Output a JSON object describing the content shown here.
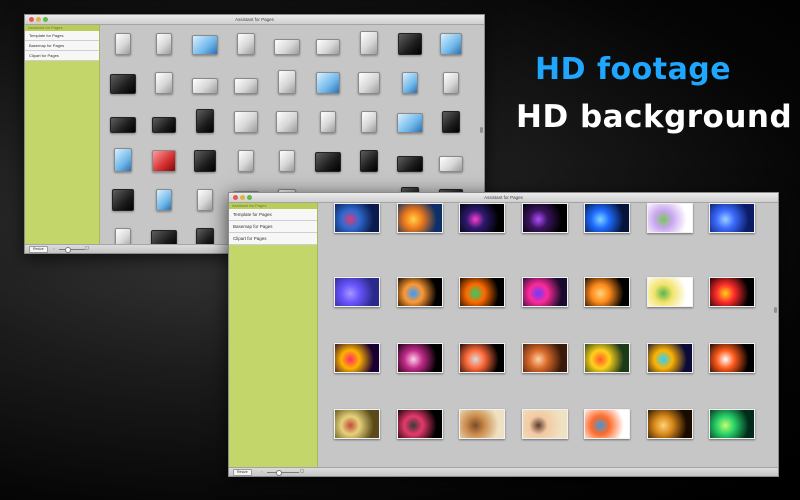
{
  "headlines": {
    "line1": "HD footage",
    "line2": "HD background",
    "color1": "#1fa6ff",
    "color2": "#ffffff"
  },
  "back_window": {
    "title": "Assistant for Pages",
    "sidebar_header": "Assistant for Pages",
    "sidebar_items": [
      "Template for Pages",
      "Basemap for Pages",
      "Clipart for Pages"
    ],
    "resize_label": "Resize",
    "zoom_small_icon": "zoom-out-icon",
    "zoom_large_icon": "zoom-in-icon",
    "zoom_level": 0.3,
    "sidebar_color": "#c2d66a",
    "items": [
      {
        "style": "light",
        "caption": ""
      },
      {
        "style": "light",
        "caption": ""
      },
      {
        "style": "blue",
        "caption": ""
      },
      {
        "style": "light",
        "caption": ""
      },
      {
        "style": "light",
        "caption": ""
      },
      {
        "style": "light",
        "caption": ""
      },
      {
        "style": "light",
        "caption": ""
      },
      {
        "style": "dark",
        "caption": ""
      },
      {
        "style": "blue",
        "caption": ""
      },
      {
        "style": "dark",
        "caption": ""
      },
      {
        "style": "light",
        "caption": ""
      },
      {
        "style": "light",
        "caption": ""
      },
      {
        "style": "light",
        "caption": ""
      },
      {
        "style": "light",
        "caption": ""
      },
      {
        "style": "blue",
        "caption": ""
      },
      {
        "style": "light",
        "caption": ""
      },
      {
        "style": "blue",
        "caption": ""
      },
      {
        "style": "light",
        "caption": ""
      },
      {
        "style": "dark",
        "caption": ""
      },
      {
        "style": "dark",
        "caption": ""
      },
      {
        "style": "dark",
        "caption": ""
      },
      {
        "style": "light",
        "caption": ""
      },
      {
        "style": "light",
        "caption": ""
      },
      {
        "style": "light",
        "caption": ""
      },
      {
        "style": "light",
        "caption": ""
      },
      {
        "style": "blue",
        "caption": ""
      },
      {
        "style": "dark",
        "caption": ""
      },
      {
        "style": "blue",
        "caption": ""
      },
      {
        "style": "red",
        "caption": ""
      },
      {
        "style": "dark",
        "caption": ""
      },
      {
        "style": "light",
        "caption": ""
      },
      {
        "style": "light",
        "caption": ""
      },
      {
        "style": "dark",
        "caption": ""
      },
      {
        "style": "dark",
        "caption": ""
      },
      {
        "style": "dark",
        "caption": ""
      },
      {
        "style": "light",
        "caption": ""
      },
      {
        "style": "dark",
        "caption": ""
      },
      {
        "style": "blue",
        "caption": ""
      },
      {
        "style": "light",
        "caption": ""
      },
      {
        "style": "light",
        "caption": ""
      },
      {
        "style": "light",
        "caption": ""
      },
      {
        "style": "light",
        "caption": ""
      },
      {
        "style": "light",
        "caption": ""
      },
      {
        "style": "dark",
        "caption": ""
      },
      {
        "style": "dark",
        "caption": ""
      },
      {
        "style": "light",
        "caption": ""
      },
      {
        "style": "dark",
        "caption": ""
      },
      {
        "style": "dark",
        "caption": ""
      }
    ]
  },
  "front_window": {
    "title": "Assistant for Pages",
    "sidebar_header": "Assistant for Pages",
    "sidebar_items": [
      "Template for Pages",
      "Basemap for Pages",
      "Clipart for Pages"
    ],
    "resize_label": "Resize",
    "zoom_small_icon": "zoom-out-icon",
    "zoom_large_icon": "zoom-in-icon",
    "zoom_level": 0.35,
    "sidebar_color": "#c2d66a",
    "items": [
      {
        "colors": [
          "#0b1b4d",
          "#2f6bd1",
          "#d93b7c"
        ],
        "caption": ""
      },
      {
        "colors": [
          "#0b2f66",
          "#f07a1a",
          "#ffd24a"
        ],
        "caption": ""
      },
      {
        "colors": [
          "#000000",
          "#2c1a6e",
          "#ff3bd0"
        ],
        "caption": ""
      },
      {
        "colors": [
          "#000000",
          "#3a145e",
          "#b24dff"
        ],
        "caption": ""
      },
      {
        "colors": [
          "#06133a",
          "#1e6bff",
          "#7fd6ff"
        ],
        "caption": ""
      },
      {
        "colors": [
          "#ffffff",
          "#c9a6f0",
          "#7ac55c"
        ],
        "caption": ""
      },
      {
        "colors": [
          "#0b1b66",
          "#3c6bff",
          "#9ad0ff"
        ],
        "caption": ""
      },
      {
        "colors": [
          "#2a2a8a",
          "#6a55ff",
          "#a699ff"
        ],
        "caption": ""
      },
      {
        "colors": [
          "#000000",
          "#ff9933",
          "#3399ff"
        ],
        "caption": ""
      },
      {
        "colors": [
          "#000000",
          "#ff6a00",
          "#2ad16a"
        ],
        "caption": ""
      },
      {
        "colors": [
          "#1a0b2e",
          "#ff2a9a",
          "#6a3bff"
        ],
        "caption": ""
      },
      {
        "colors": [
          "#000000",
          "#ff8a1a",
          "#ffd47a"
        ],
        "caption": ""
      },
      {
        "colors": [
          "#ffffff",
          "#f2e36a",
          "#5ab44a"
        ],
        "caption": ""
      },
      {
        "colors": [
          "#000000",
          "#ff2a2a",
          "#ffd21a"
        ],
        "caption": ""
      },
      {
        "colors": [
          "#1a0033",
          "#ffb300",
          "#ff2a6a"
        ],
        "caption": ""
      },
      {
        "colors": [
          "#000000",
          "#c22a8a",
          "#ffd1e6"
        ],
        "caption": ""
      },
      {
        "colors": [
          "#000000",
          "#ff6a3a",
          "#d9d9d9"
        ],
        "caption": ""
      },
      {
        "colors": [
          "#3a1a0b",
          "#d96a2a",
          "#ffd1a6"
        ],
        "caption": ""
      },
      {
        "colors": [
          "#1a3a1a",
          "#ffd21a",
          "#ff5a2a"
        ],
        "caption": ""
      },
      {
        "colors": [
          "#0b0b3a",
          "#ffb300",
          "#2ad1ff"
        ],
        "caption": ""
      },
      {
        "colors": [
          "#000000",
          "#ff5a1a",
          "#ffffff"
        ],
        "caption": ""
      },
      {
        "colors": [
          "#5a4a1a",
          "#e6d27a",
          "#c44a3a"
        ],
        "caption": ""
      },
      {
        "colors": [
          "#000000",
          "#e63a6a",
          "#3a3a3a"
        ],
        "caption": ""
      },
      {
        "colors": [
          "#efe2c2",
          "#c98a4a",
          "#7a4a2a"
        ],
        "caption": ""
      },
      {
        "colors": [
          "#efe2c2",
          "#f2c9a2",
          "#5a3a2a"
        ],
        "caption": ""
      },
      {
        "colors": [
          "#ffffff",
          "#ff6a2a",
          "#3a9ad9"
        ],
        "caption": ""
      },
      {
        "colors": [
          "#1a0b00",
          "#d98a1a",
          "#ffd27a"
        ],
        "caption": ""
      },
      {
        "colors": [
          "#002a1a",
          "#2ad16a",
          "#c2ff6a"
        ],
        "caption": ""
      },
      {
        "colors": [
          "#001a1a",
          "#2ad1c2",
          "#ff2a6a"
        ],
        "caption": ""
      },
      {
        "colors": [
          "#3a0b5e",
          "#ff5a2a",
          "#ffd21a"
        ],
        "caption": ""
      },
      {
        "colors": [
          "#0b3a2a",
          "#2ab46a",
          "#c2ffd1"
        ],
        "caption": ""
      },
      {
        "colors": [
          "#000000",
          "#6a2aff",
          "#ffffff"
        ],
        "caption": ""
      },
      {
        "colors": [
          "#0b1b4d",
          "#2a6ad1",
          "#ffffff"
        ],
        "caption": ""
      },
      {
        "colors": [
          "#000000",
          "#d92a2a",
          "#ffb300"
        ],
        "caption": ""
      },
      {
        "colors": [
          "#000000",
          "#ff5a1a",
          "#ffd21a"
        ],
        "caption": ""
      }
    ]
  }
}
